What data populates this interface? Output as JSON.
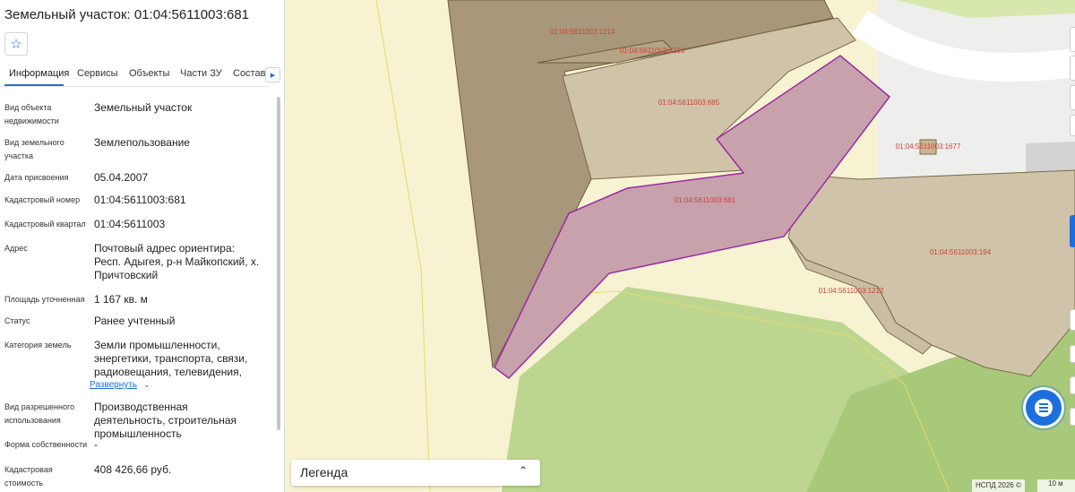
{
  "panel": {
    "title": "Земельный участок: 01:04:5611003:681",
    "tabs": [
      "Информация",
      "Сервисы",
      "Объекты",
      "Части ЗУ",
      "Состав"
    ],
    "fields": [
      {
        "label": "Вид объекта недвижимости",
        "value": "Земельный участок"
      },
      {
        "label": "Вид земельного участка",
        "value": "Землепользование"
      },
      {
        "label": "Дата присвоения",
        "value": "05.04.2007"
      },
      {
        "label": "Кадастровый номер",
        "value": "01:04:5611003:681"
      },
      {
        "label": "Кадастровый квартал",
        "value": "01:04:5611003"
      },
      {
        "label": "Адрес",
        "value": "Почтовый адрес ориентира: Респ. Адыгея, р-н Майкопский, х. Причтовский"
      },
      {
        "label": "Площадь уточненная",
        "value": "1 167 кв. м"
      },
      {
        "label": "Статус",
        "value": "Ранее учтенный"
      },
      {
        "label": "Категория земель",
        "value": "Земли промышленности, энергетики, транспорта, связи, радиовещания, телевидения,"
      },
      {
        "label": "Вид разрешенного использования",
        "value": "Производственная деятельность, строительная промышленность"
      },
      {
        "label": "Форма собственности",
        "value": "-"
      },
      {
        "label": "Кадастровая стоимость",
        "value": "408 426,66 руб."
      }
    ],
    "expand_label": "Развернуть"
  },
  "map": {
    "parcels": [
      {
        "id": "01:04:5611003:1214",
        "fill": "#a8977a"
      },
      {
        "id": "01:04:5611003:1213",
        "fill": "#b6a584"
      },
      {
        "id": "01:04:5611003:685",
        "fill": "#cfc3a9"
      },
      {
        "id": "01:04:5611003:681",
        "fill": "#c7a2ad",
        "selected": true
      },
      {
        "id": "01:04:5611003:1677",
        "fill": "#cbb691"
      },
      {
        "id": "01:04:5611003:194",
        "fill": "#cfc3a9"
      },
      {
        "id": "01:04:5611003:1212",
        "fill": "#c9bda4"
      }
    ],
    "label_color": "#c8453c",
    "selected_stroke": "#9b2ba1"
  },
  "legend": {
    "label": "Легенда"
  },
  "footer": {
    "copyright": "НСПД 2026 ©",
    "scale": "10 м"
  }
}
